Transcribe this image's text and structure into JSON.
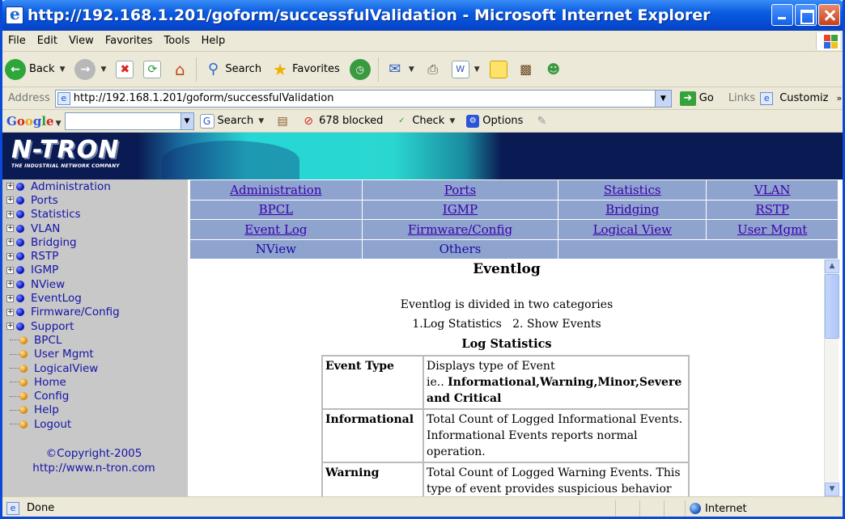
{
  "window": {
    "title": "http://192.168.1.201/goform/successfulValidation - Microsoft Internet Explorer"
  },
  "menu": [
    "File",
    "Edit",
    "View",
    "Favorites",
    "Tools",
    "Help"
  ],
  "toolbar": {
    "back_label": "Back",
    "search_label": "Search",
    "favorites_label": "Favorites"
  },
  "address": {
    "label": "Address",
    "url": "http://192.168.1.201/goform/successfulValidation",
    "go_label": "Go",
    "links_label": "Links",
    "customize_label": "Customiz"
  },
  "googlebar": {
    "search_label": "Search",
    "blocked_label": "678 blocked",
    "check_label": "Check",
    "options_label": "Options"
  },
  "banner": {
    "logo_text": "N-TRON",
    "logo_sub": "THE INDUSTRIAL NETWORK COMPANY"
  },
  "sidebar": {
    "items": [
      {
        "label": "Administration",
        "expandable": true
      },
      {
        "label": "Ports",
        "expandable": true
      },
      {
        "label": "Statistics",
        "expandable": true
      },
      {
        "label": "VLAN",
        "expandable": true
      },
      {
        "label": "Bridging",
        "expandable": true
      },
      {
        "label": "RSTP",
        "expandable": true
      },
      {
        "label": "IGMP",
        "expandable": true
      },
      {
        "label": "NView",
        "expandable": true
      },
      {
        "label": "EventLog",
        "expandable": true
      },
      {
        "label": "Firmware/Config",
        "expandable": true
      },
      {
        "label": "Support",
        "expandable": true
      },
      {
        "label": "BPCL",
        "expandable": false
      },
      {
        "label": "User Mgmt",
        "expandable": false
      },
      {
        "label": "LogicalView",
        "expandable": false
      },
      {
        "label": "Home",
        "expandable": false
      },
      {
        "label": "Config",
        "expandable": false
      },
      {
        "label": "Help",
        "expandable": false
      },
      {
        "label": "Logout",
        "expandable": false
      }
    ],
    "copyright": "©Copyright-2005",
    "website": "http://www.n-tron.com"
  },
  "nav": {
    "rows": [
      [
        "Administration",
        "Ports",
        "Statistics",
        "VLAN"
      ],
      [
        "BPCL",
        "IGMP",
        "Bridging",
        "RSTP"
      ],
      [
        "Event Log",
        "Firmware/Config",
        "Logical View",
        "User Mgmt"
      ],
      [
        "NView",
        "Others",
        "",
        ""
      ]
    ]
  },
  "content": {
    "title": "Eventlog",
    "intro": "Eventlog is divided in two categories",
    "categories": "1.Log Statistics   2. Show Events",
    "subtitle": "Log Statistics",
    "rows": [
      {
        "key": "Event Type",
        "desc": "Displays type of Event",
        "desc2_prefix": "ie.. ",
        "desc2_bold": "Informational,Warning,Minor,Severe and Critical"
      },
      {
        "key": "Informational",
        "desc": "Total Count of Logged Informational Events. Informational Events reports normal operation."
      },
      {
        "key": "Warning",
        "desc": "Total Count of Logged Warning Events. This type of event provides suspicious behavior that may or may not affect the system."
      }
    ]
  },
  "status": {
    "left": "Done",
    "zone": "Internet"
  },
  "colors": {
    "nav_bg": "#8fa3cf",
    "sidebar_bg": "#c8c8c8",
    "banner_bg": "#0a1a52",
    "link": "#3a00aa"
  }
}
